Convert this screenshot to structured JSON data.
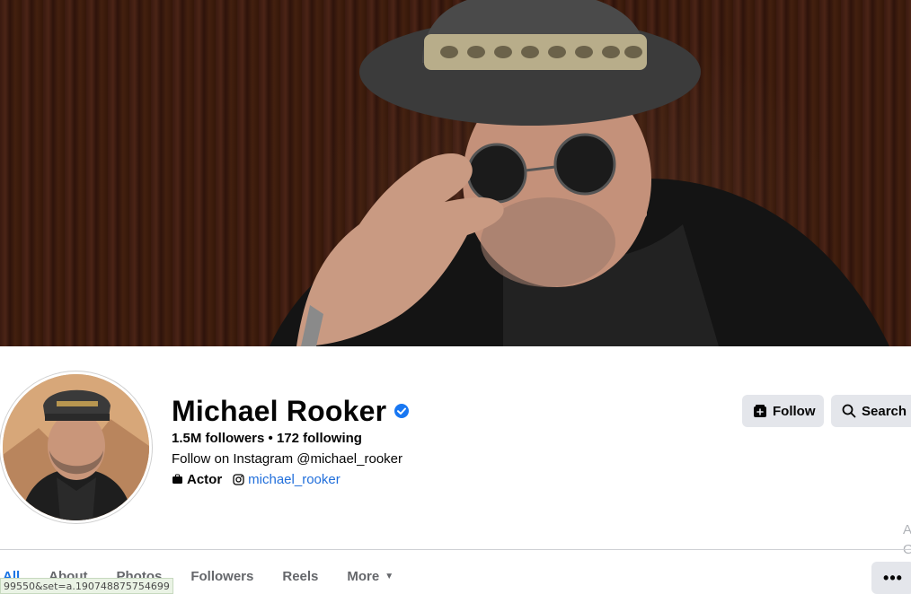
{
  "profile": {
    "name": "Michael Rooker",
    "stats": "1.5M followers • 172 following",
    "intro": "Follow on Instagram @michael_rooker",
    "category": "Actor",
    "instagram_handle": "michael_rooker",
    "verified_icon": "verified-badge-icon"
  },
  "actions": {
    "follow_label": "Follow",
    "search_label": "Search",
    "more_label": "•••"
  },
  "tabs": [
    {
      "label": "All"
    },
    {
      "label": "About"
    },
    {
      "label": "Photos"
    },
    {
      "label": "Followers"
    },
    {
      "label": "Reels"
    },
    {
      "label": "More"
    }
  ],
  "side_letters": [
    "A",
    "G"
  ],
  "status_bar": "99550&set=a.190748875754699",
  "colors": {
    "accent": "#1b74e4",
    "link": "#216fdb",
    "button_bg": "#e4e6eb",
    "verified": "#1877f2"
  }
}
